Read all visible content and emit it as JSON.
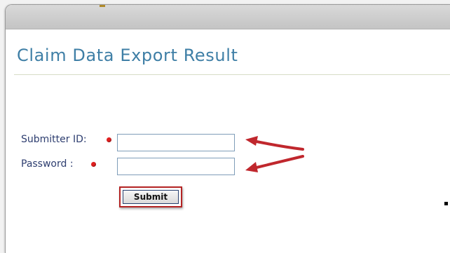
{
  "page": {
    "title": "Claim Data Export Result"
  },
  "form": {
    "submitter_id_label": "Submitter ID:",
    "submitter_id_value": "",
    "password_label": "Password :",
    "password_value": "",
    "submit_label": "Submit"
  },
  "colors": {
    "title": "#3f7fa6",
    "label": "#2e3e70",
    "required_marker": "#e02020",
    "annotation": "#c0272d"
  },
  "icons": [
    "required-marker-icon",
    "annotation-arrow-icon"
  ]
}
